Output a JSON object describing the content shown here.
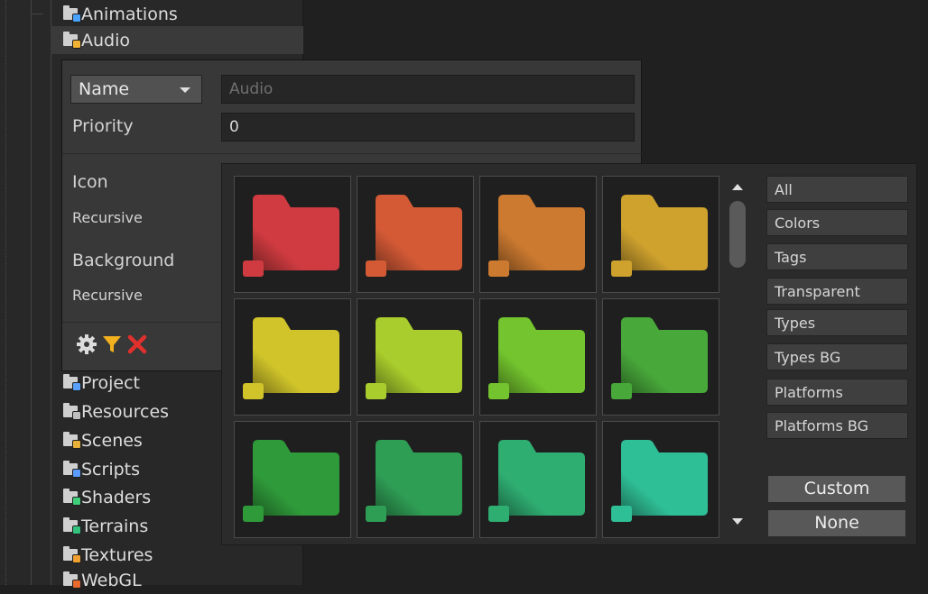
{
  "tree": {
    "items": [
      {
        "label": "Animations",
        "badge_color": "#4aa3ff"
      },
      {
        "label": "Audio",
        "badge_color": "#f2b234"
      },
      {
        "label": "Project",
        "badge_color": "#5aa0ff"
      },
      {
        "label": "Resources",
        "badge_color": "#bdbdbd"
      },
      {
        "label": "Scenes",
        "badge_color": "#e7b13a"
      },
      {
        "label": "Scripts",
        "badge_color": "#5a9bff"
      },
      {
        "label": "Shaders",
        "badge_color": "#3fcf7a"
      },
      {
        "label": "Terrains",
        "badge_color": "#32c27d"
      },
      {
        "label": "Textures",
        "badge_color": "#f0a030"
      },
      {
        "label": "WebGL",
        "badge_color": "#e86a2e"
      }
    ]
  },
  "settings": {
    "name_dropdown": "Name",
    "name_placeholder": "Audio",
    "priority_label": "Priority",
    "priority_value": "0",
    "icon_label": "Icon",
    "icon_recursive": "Recursive",
    "background_label": "Background",
    "background_recursive": "Recursive"
  },
  "picker": {
    "folder_colors": [
      "#cf3b40",
      "#d45a36",
      "#cc7a30",
      "#cfa22e",
      "#d0c42a",
      "#a9cd2c",
      "#73c42e",
      "#48a83a",
      "#2f9a3a",
      "#2f9e55",
      "#2fae72",
      "#2fbf96"
    ],
    "categories": [
      "All",
      "Colors",
      "Tags",
      "Transparent",
      "Types",
      "Types BG",
      "Platforms",
      "Platforms BG"
    ],
    "custom_label": "Custom",
    "none_label": "None"
  }
}
